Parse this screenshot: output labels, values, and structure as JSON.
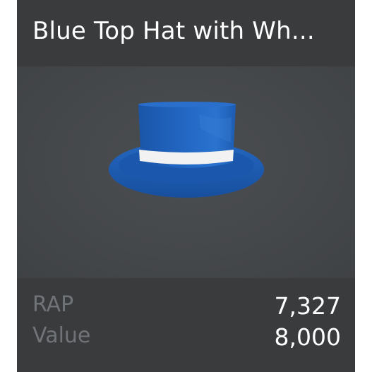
{
  "item": {
    "title": "Blue Top Hat with Wh...",
    "thumbnail_icon": "blue-top-hat-icon",
    "colors": {
      "hat_blue": "#1d5db6",
      "band_white": "#f2f2f2",
      "card_bg": "#393b3d",
      "thumb_bg": "#45484b"
    }
  },
  "stats": {
    "rap_label": "RAP",
    "rap_value": "7,327",
    "value_label": "Value",
    "value_value": "8,000"
  }
}
